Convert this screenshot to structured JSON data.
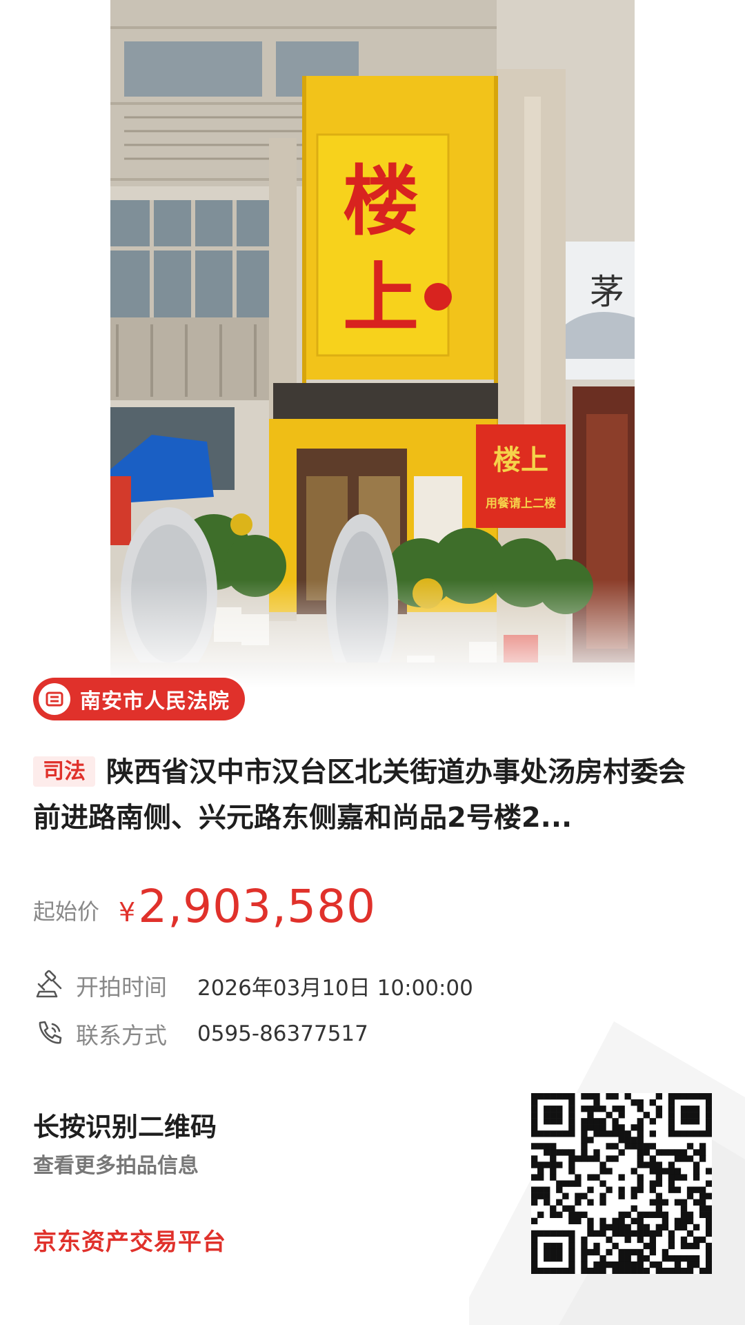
{
  "court": {
    "name": "南安市人民法院",
    "icon": "court-gavel-icon"
  },
  "listing": {
    "tag": "司法",
    "title": "陕西省汉中市汉台区北关街道办事处汤房村委会前进路南侧、兴元路东侧嘉和尚品2号楼2..."
  },
  "price": {
    "label": "起始价",
    "currency": "¥",
    "value": "2,903,580"
  },
  "info": {
    "start_time": {
      "label": "开拍时间",
      "value": "2026年03月10日 10:00:00",
      "icon": "auction-hammer-icon"
    },
    "contact": {
      "label": "联系方式",
      "value": "0595-86377517",
      "icon": "phone-icon"
    }
  },
  "qr_prompt": {
    "title": "长按识别二维码",
    "subtitle": "查看更多拍品信息"
  },
  "platform": {
    "name": "京东资产交易平台"
  },
  "photo_signs": {
    "main": "楼上",
    "small": "楼上",
    "small_sub": "用餐请上二楼",
    "right": "茅"
  },
  "colors": {
    "accent": "#e0312b",
    "tag_bg": "#fdeceb",
    "sign_yellow": "#f2c31a"
  }
}
